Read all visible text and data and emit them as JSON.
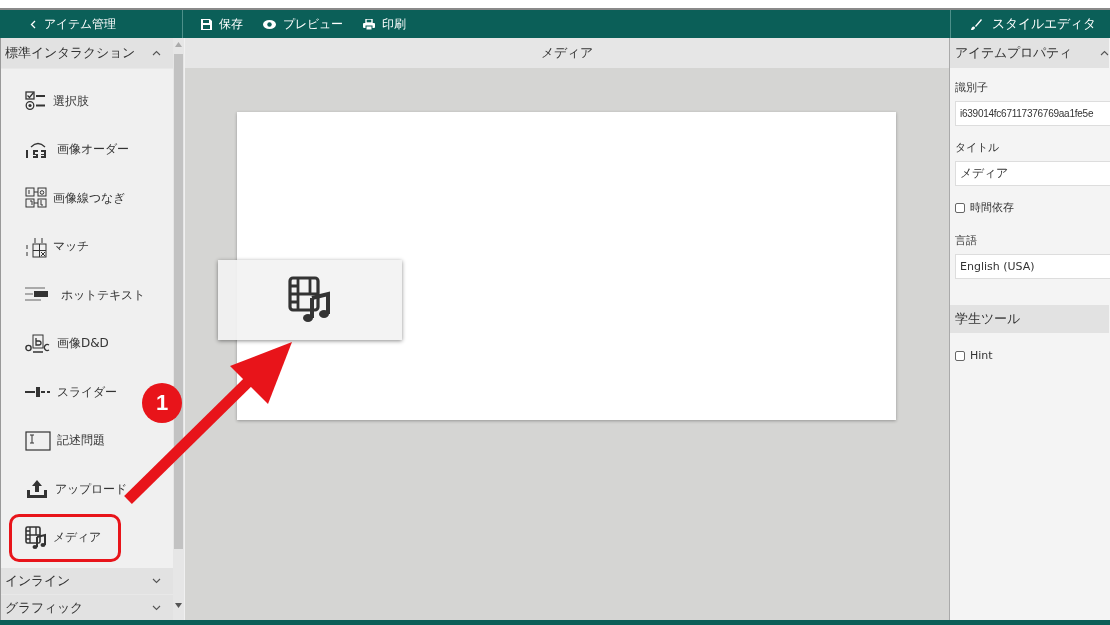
{
  "top_bar": {
    "back": "アイテム管理",
    "tools": [
      {
        "kind": "save",
        "label": "保存"
      },
      {
        "kind": "preview",
        "label": "プレビュー"
      },
      {
        "kind": "print",
        "label": "印刷"
      }
    ],
    "style_editor": "スタイルエディタ"
  },
  "sidebar": {
    "sections": [
      {
        "title": "標準インタラクション",
        "expanded": true,
        "items": [
          {
            "label": "選択肢",
            "kind": "choice",
            "annotated": false
          },
          {
            "label": "画像オーダー",
            "kind": "order",
            "annotated": false
          },
          {
            "label": "画像線つなぎ",
            "kind": "line",
            "annotated": false
          },
          {
            "label": "マッチ",
            "kind": "match",
            "annotated": false
          },
          {
            "label": "ホットテキスト",
            "kind": "hottext",
            "annotated": false
          },
          {
            "label": "画像D&D",
            "kind": "dnd",
            "annotated": false
          },
          {
            "label": "スライダー",
            "kind": "slider",
            "annotated": false
          },
          {
            "label": "記述問題",
            "kind": "essay",
            "annotated": false
          },
          {
            "label": "アップロード",
            "kind": "upload",
            "annotated": false
          },
          {
            "label": "メディア",
            "kind": "media",
            "annotated": true
          }
        ]
      },
      {
        "title": "インライン",
        "expanded": false
      },
      {
        "title": "グラフィック",
        "expanded": false
      }
    ]
  },
  "canvas": {
    "title": "メディア"
  },
  "annotation": {
    "badge": "1"
  },
  "properties": {
    "sections": [
      {
        "title": "アイテムプロパティ",
        "expanded": true,
        "fields": [
          {
            "kind": "text",
            "label": "識別子",
            "value": "i639014fc67117376769aa1fe5e"
          },
          {
            "kind": "text",
            "label": "タイトル",
            "value": "メディア"
          },
          {
            "kind": "checkbox",
            "label": "時間依存",
            "checked": false
          },
          {
            "kind": "select",
            "label": "言語",
            "value": "English (USA)"
          }
        ]
      },
      {
        "title": "学生ツール",
        "fields": [
          {
            "kind": "checkbox",
            "label": "Hint",
            "checked": false
          }
        ]
      }
    ]
  }
}
